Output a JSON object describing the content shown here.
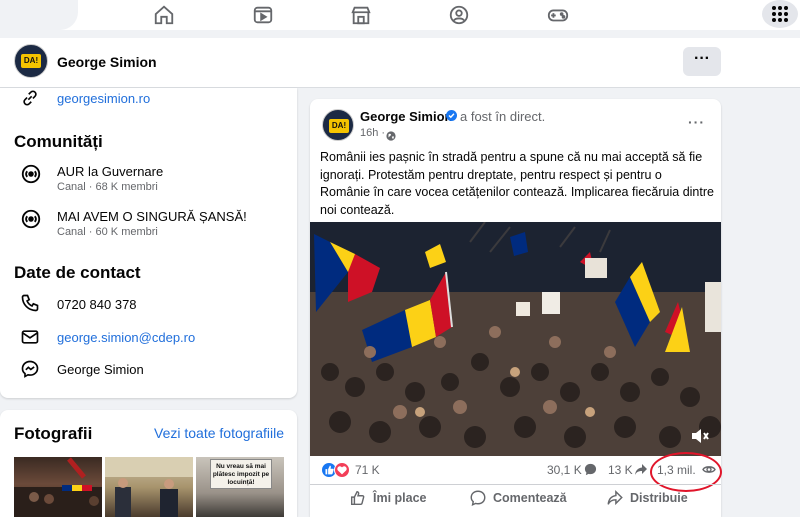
{
  "profile": {
    "name": "George Simion",
    "avatar_badge": "DA!"
  },
  "intro": {
    "website": "georgesimion.ro",
    "communities_title": "Comunități",
    "communities": [
      {
        "name": "AUR la Guvernare",
        "sub": "Canal · 68 K membri"
      },
      {
        "name": "MAI AVEM O SINGURĂ ȘANSĂ!",
        "sub": "Canal · 60 K membri"
      }
    ],
    "contact_title": "Date de contact",
    "phone": "0720 840 378",
    "email": "george.simion@cdep.ro",
    "messenger": "George Simion"
  },
  "photos": {
    "title": "Fotografii",
    "see_all": "Vezi toate fotografiile",
    "sign_text": "Nu vreau să mai plătesc impozit pe locuință!"
  },
  "post": {
    "author": "George Simion",
    "status": "a fost în direct.",
    "time": "16h ·",
    "text": "Românii ies pașnic în stradă pentru a spune că nu mai acceptă să fie ignorați. Protestăm pentru dreptate, pentru respect și pentru o Românie în care vocea cetățenilor contează. Implicarea fiecăruia dintre noi contează.",
    "reactions_count": "71 K",
    "comments_count": "30,1 K",
    "shares_count": "13 K",
    "views_count": "1,3 mil.",
    "actions": {
      "like": "Îmi place",
      "comment": "Comentează",
      "share": "Distribuie"
    }
  },
  "colors": {
    "link": "#216fdb",
    "facebook_blue": "#1877f2",
    "highlight_circle": "#e0152a"
  },
  "icons": [
    "home-icon",
    "video-icon",
    "marketplace-icon",
    "groups-icon",
    "gaming-icon",
    "menu-grid-icon",
    "link-icon",
    "community-icon",
    "phone-icon",
    "mail-icon",
    "messenger-icon",
    "globe-icon",
    "verified-icon",
    "volume-icon",
    "eye-icon"
  ]
}
